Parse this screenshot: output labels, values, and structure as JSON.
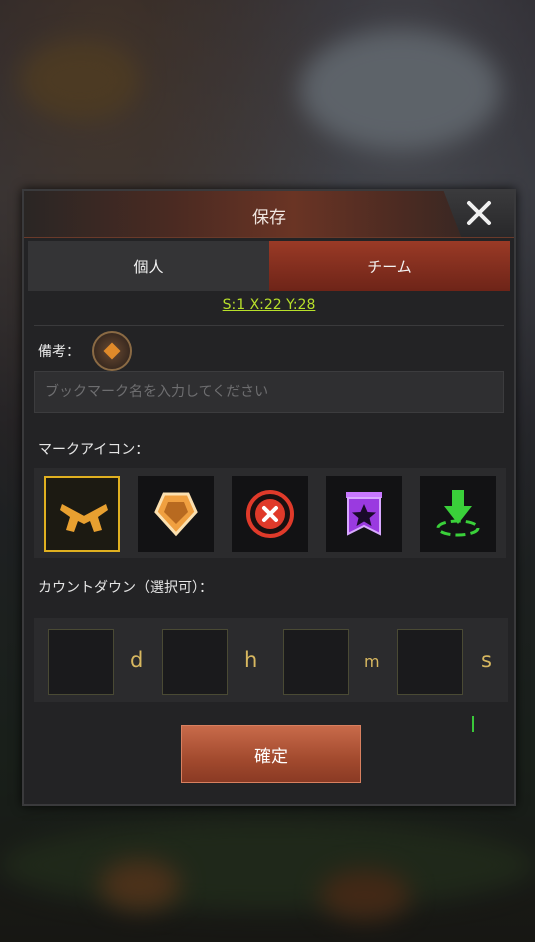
{
  "dialog": {
    "title": "保存",
    "close_icon": "close-icon"
  },
  "tabs": [
    {
      "label": "個人",
      "active": false
    },
    {
      "label": "チーム",
      "active": true
    }
  ],
  "coordinates": "S:1 X:22 Y:28",
  "note": {
    "label": "備考：",
    "placeholder": "ブックマーク名を入力してください",
    "value": ""
  },
  "mark_icons": {
    "label": "マークアイコン：",
    "items": [
      {
        "icon": "crossed-pistols-icon",
        "selected": true,
        "color": "#e8a030"
      },
      {
        "icon": "shield-badge-icon",
        "selected": false,
        "color": "#f0a040"
      },
      {
        "icon": "red-x-icon",
        "selected": false,
        "color": "#e03a2a"
      },
      {
        "icon": "purple-star-banner-icon",
        "selected": false,
        "color": "#9a3ae0"
      },
      {
        "icon": "green-arrow-target-icon",
        "selected": false,
        "color": "#3ad03a"
      }
    ]
  },
  "countdown": {
    "label": "カウントダウン（選択可）：",
    "fields": [
      {
        "unit": "d",
        "value": ""
      },
      {
        "unit": "h",
        "value": ""
      },
      {
        "unit": "m",
        "value": ""
      },
      {
        "unit": "s",
        "value": ""
      }
    ]
  },
  "confirm_label": "確定",
  "colors": {
    "accent": "#a24a2e",
    "coordinates": "#b8e02a",
    "selected_border": "#e0b020"
  }
}
